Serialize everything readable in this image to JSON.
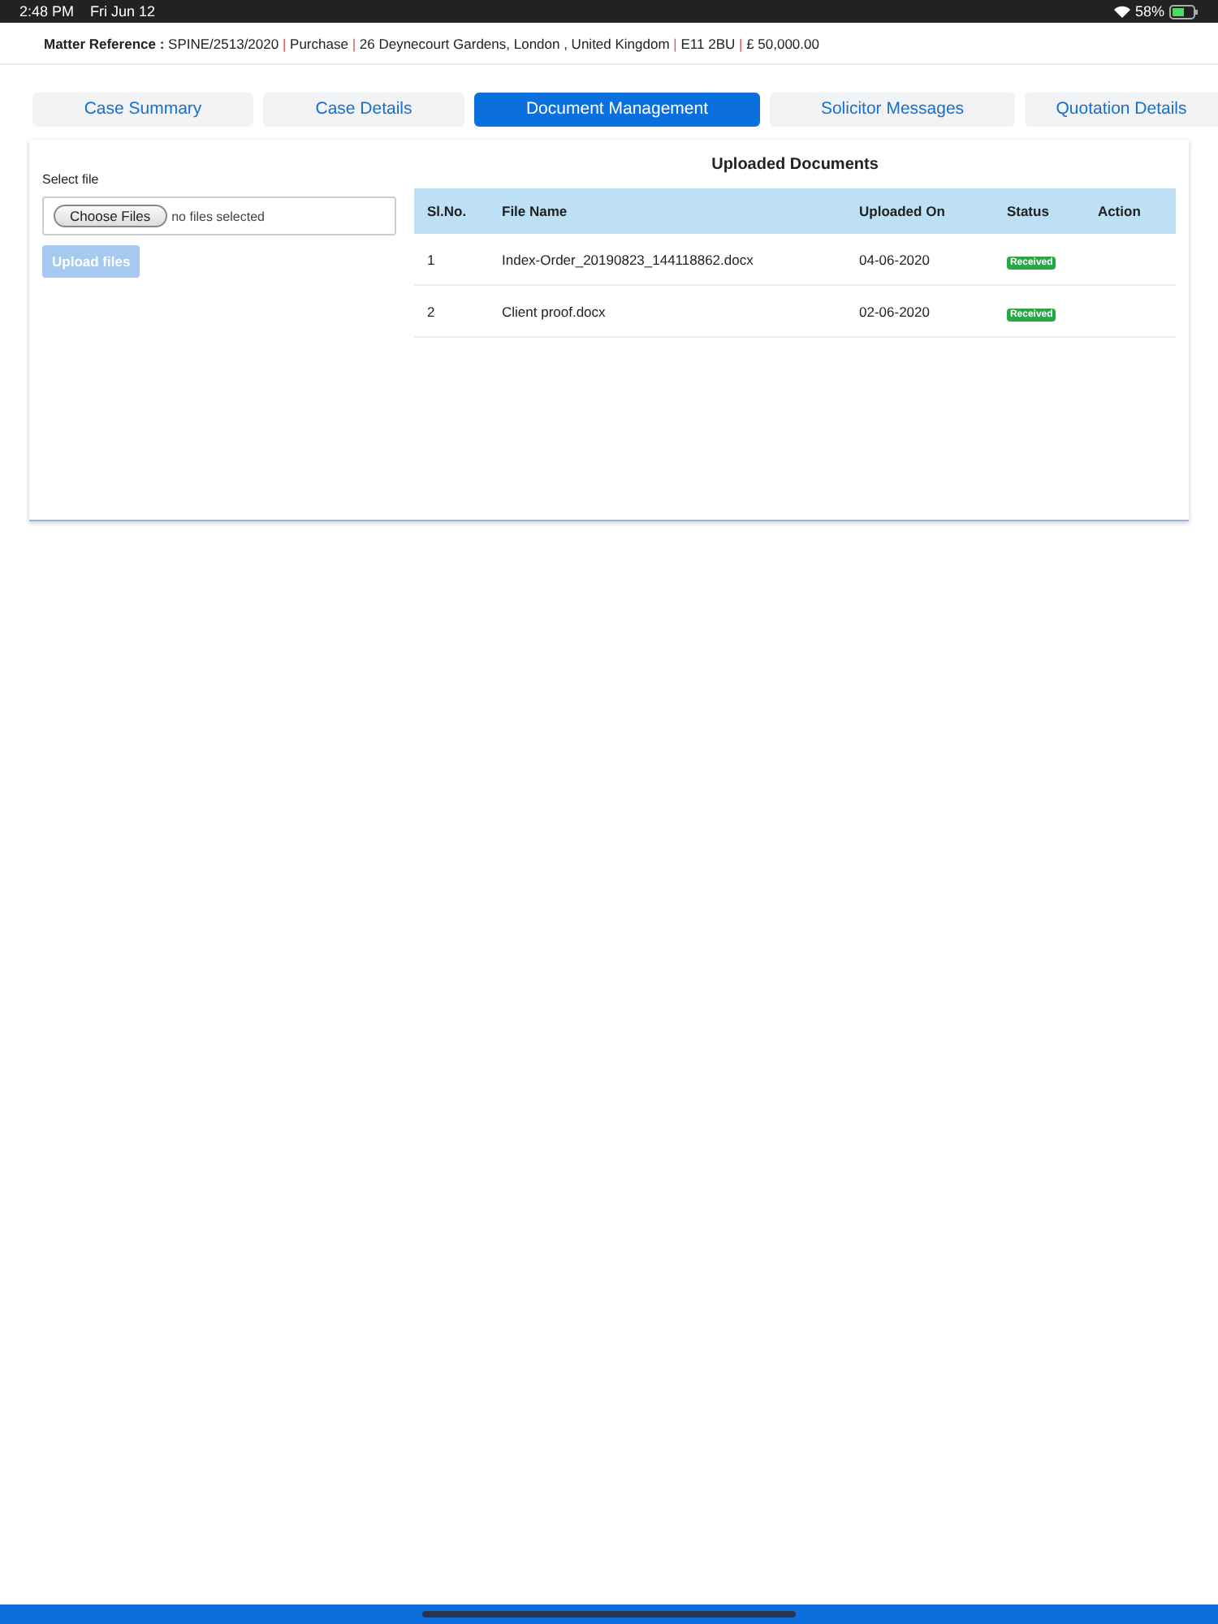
{
  "status_bar": {
    "time": "2:48 PM",
    "date": "Fri Jun 12",
    "battery": "58%"
  },
  "matter": {
    "label": "Matter Reference :",
    "separator": "|",
    "parts": [
      "SPINE/2513/2020",
      "Purchase",
      "26 Deynecourt Gardens, London , United Kingdom",
      "E11 2BU",
      "£ 50,000.00"
    ]
  },
  "tabs": [
    {
      "label": "Case Summary",
      "selected": false
    },
    {
      "label": "Case Details",
      "selected": false
    },
    {
      "label": "Document Management",
      "selected": true
    },
    {
      "label": "Solicitor Messages",
      "selected": false
    },
    {
      "label": "Quotation Details",
      "selected": false
    }
  ],
  "upload": {
    "label": "Select file",
    "choose_button": "Choose Files",
    "file_status": "no files selected",
    "upload_button": {
      "label": "Upload files",
      "disabled": true
    }
  },
  "documents": {
    "title": "Uploaded Documents",
    "columns": [
      "Sl.No.",
      "File Name",
      "Uploaded On",
      "Status",
      "Action"
    ],
    "rows": [
      {
        "no": "1",
        "file": "Index-Order_20190823_144118862.docx",
        "date": "04-06-2020",
        "status": "Received"
      },
      {
        "no": "2",
        "file": "Client proof.docx",
        "date": "02-06-2020",
        "status": "Received"
      }
    ]
  }
}
